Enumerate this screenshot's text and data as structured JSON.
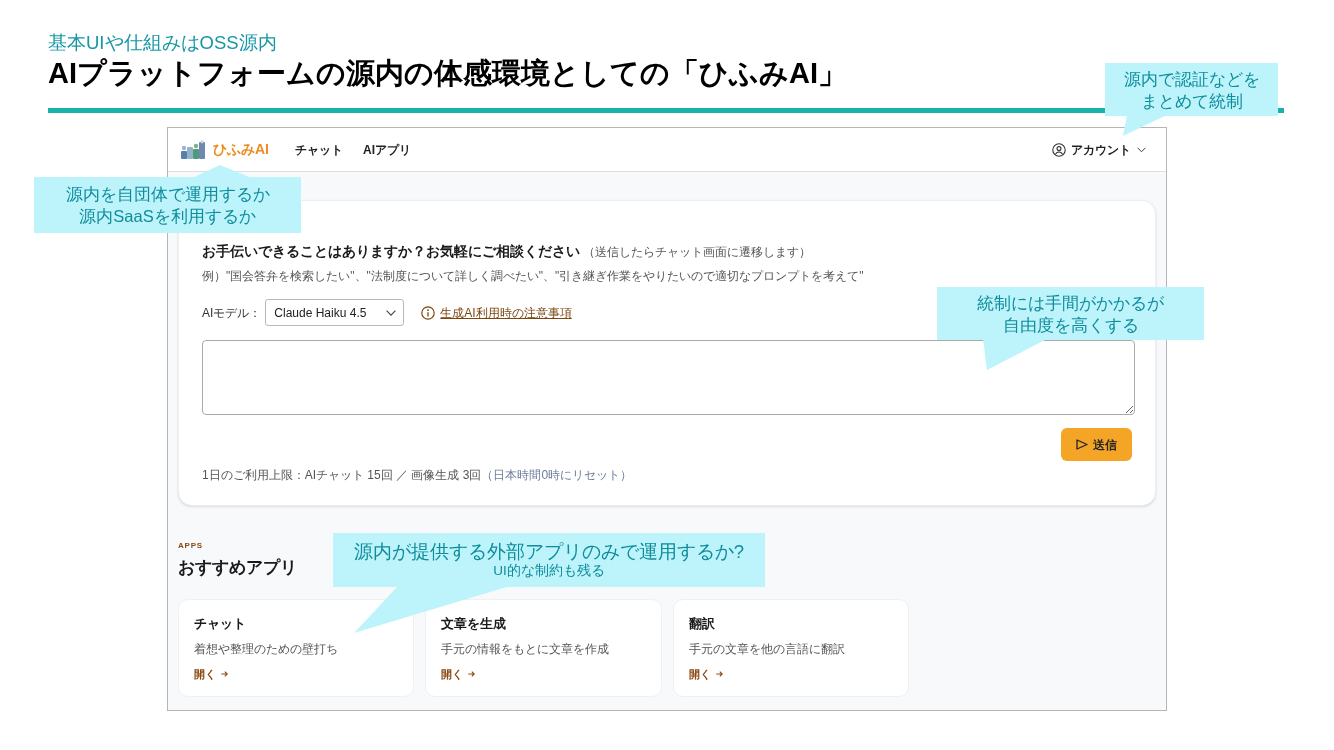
{
  "slide": {
    "subtitle": "基本UIや仕組みはOSS源内",
    "title": "AIプラットフォームの源内の体感環境としての「ひふみAI」"
  },
  "app": {
    "header": {
      "brand": "ひふみAI",
      "nav": [
        {
          "label": "チャット"
        },
        {
          "label": "AIアプリ"
        }
      ],
      "account": "アカウント"
    },
    "prompt": {
      "heading": "お手伝いできることはありますか？お気軽にご相談ください",
      "heading_note": "（送信したらチャット画面に遷移します）",
      "examples": "例）\"国会答弁を検索したい\"、\"法制度について詳しく調べたい\"、\"引き継ぎ作業をやりたいので適切なプロンプトを考えて\"",
      "model_label": "AIモデル：",
      "model": "Claude Haiku 4.5",
      "notice_link": "生成AI利用時の注意事項",
      "send_button": "送信",
      "usage": "1日のご利用上限：AIチャット 15回 ／ 画像生成 3回",
      "usage_note": "（日本時間0時にリセット）"
    },
    "apps": {
      "eyebrow": "APPS",
      "heading": "おすすめアプリ",
      "items": [
        {
          "title": "チャット",
          "description": "着想や整理のための壁打ち",
          "link": "開く"
        },
        {
          "title": "文章を生成",
          "description": "手元の情報をもとに文章を作成",
          "link": "開く"
        },
        {
          "title": "翻訳",
          "description": "手元の文章を他の言語に翻訳",
          "link": "開く"
        }
      ]
    }
  },
  "callouts": [
    {
      "lines": [
        "源内で認証などを",
        "まとめて統制"
      ]
    },
    {
      "lines": [
        "源内を自団体で運用するか",
        "源内SaaSを利用するか"
      ]
    },
    {
      "lines": [
        "統制には手間がかかるが",
        "自由度を高くする"
      ]
    },
    {
      "lines": [
        "源内が提供する外部アプリのみで運用するか?"
      ],
      "note": "UI的な制約も残る"
    }
  ]
}
